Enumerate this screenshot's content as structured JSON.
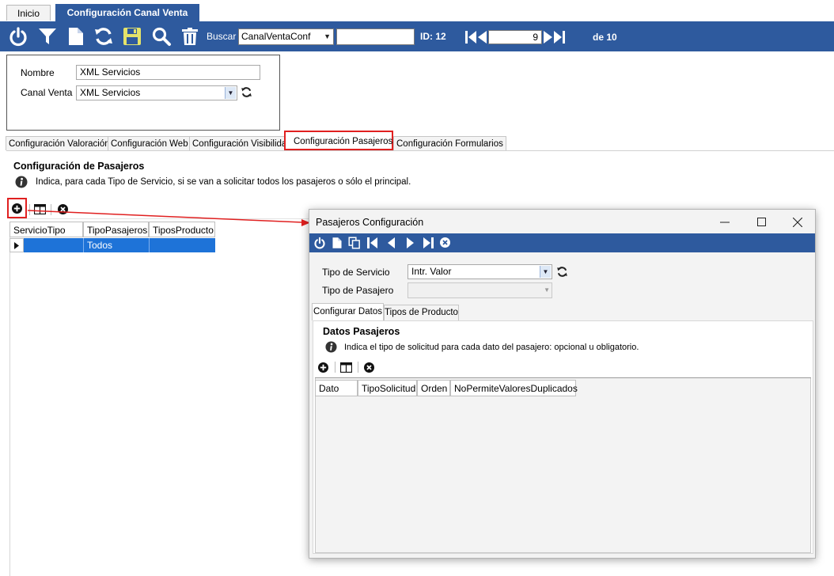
{
  "top_tabs": {
    "home": "Inicio",
    "current": "Configuración Canal Venta"
  },
  "toolbar": {
    "search_label": "Buscar",
    "search_entity": "CanalVentaConf",
    "search_value": "",
    "id_label": "ID: 12",
    "current_record": "9",
    "of_total": "de 10"
  },
  "form": {
    "name_label": "Nombre",
    "name_value": "XML Servicios",
    "channel_label": "Canal Venta",
    "channel_value": "XML Servicios"
  },
  "tabs": [
    {
      "label": "Configuración Valoración"
    },
    {
      "label": "Configuración Web"
    },
    {
      "label": "Configuración Visibilidad"
    },
    {
      "label": "Configuración Pasajeros"
    },
    {
      "label": "Configuración Formularios"
    }
  ],
  "section": {
    "title": "Configuración de Pasajeros",
    "info": "Indica, para cada Tipo de Servicio, si se van a solicitar todos los pasajeros o sólo el principal."
  },
  "grid": {
    "columns": [
      "ServicioTipo",
      "TipoPasajeros",
      "TiposProducto"
    ],
    "rows": [
      {
        "tipo_pasajeros": "Todos"
      }
    ]
  },
  "dialog": {
    "title": "Pasajeros Configuración",
    "service_type_label": "Tipo de Servicio",
    "service_type_value": "Intr. Valor",
    "passenger_type_label": "Tipo de Pasajero",
    "passenger_type_value": "",
    "tabs": [
      "Configurar Datos",
      "Tipos de Producto"
    ],
    "section_title": "Datos Pasajeros",
    "section_info": "Indica el tipo de solicitud para cada dato del pasajero: opcional u obligatorio.",
    "columns": [
      "Dato",
      "TipoSolicitud",
      "Orden",
      "NoPermiteValoresDuplicados"
    ]
  },
  "colors": {
    "toolbar_blue": "#2e5a9e",
    "selection_blue": "#1e73d8",
    "highlight_red": "#e02020",
    "save_icon_yellow": "#e4e36a"
  }
}
